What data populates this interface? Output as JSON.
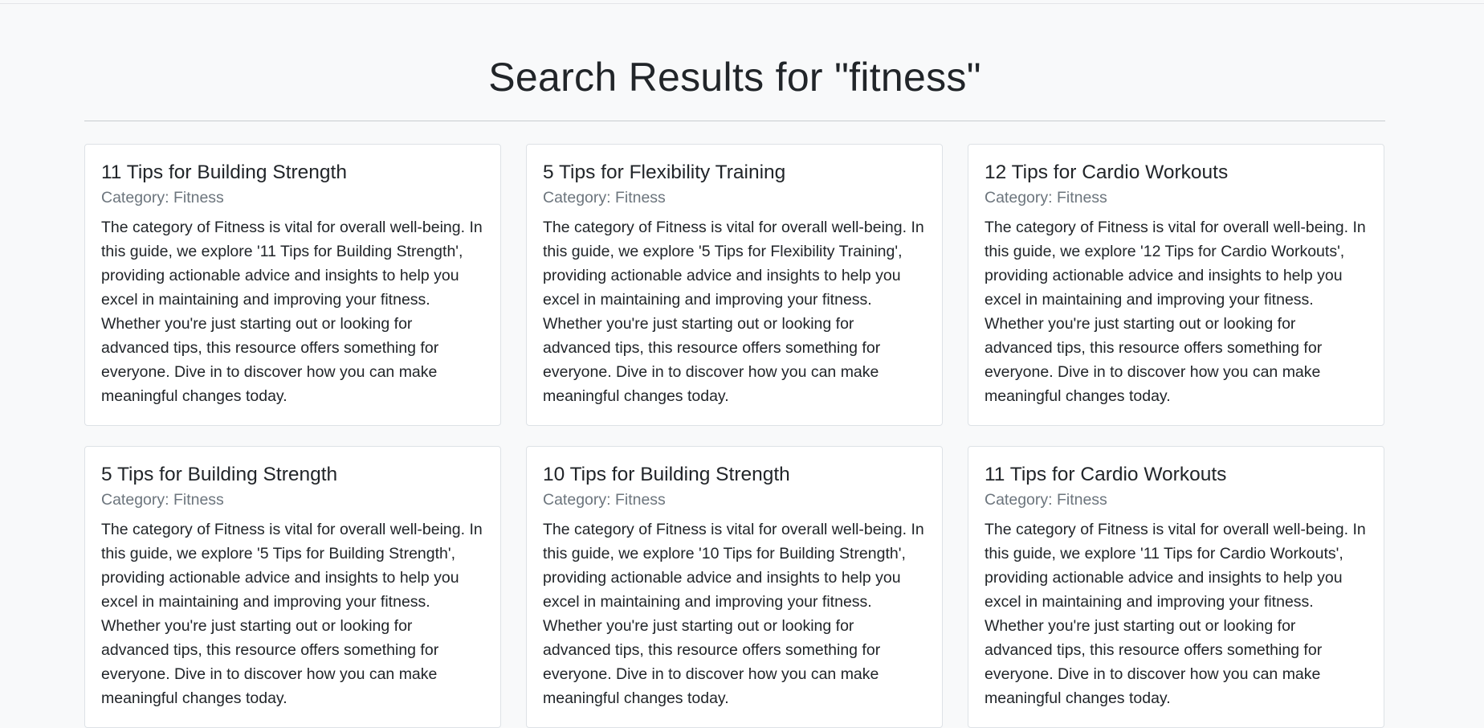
{
  "page": {
    "title": "Search Results for \"fitness\""
  },
  "results": [
    {
      "title": "11 Tips for Building Strength",
      "category": "Category: Fitness",
      "description": "The category of Fitness is vital for overall well-being. In this guide, we explore '11 Tips for Building Strength', providing actionable advice and insights to help you excel in maintaining and improving your fitness. Whether you're just starting out or looking for advanced tips, this resource offers something for everyone. Dive in to discover how you can make meaningful changes today."
    },
    {
      "title": "5 Tips for Flexibility Training",
      "category": "Category: Fitness",
      "description": "The category of Fitness is vital for overall well-being. In this guide, we explore '5 Tips for Flexibility Training', providing actionable advice and insights to help you excel in maintaining and improving your fitness. Whether you're just starting out or looking for advanced tips, this resource offers something for everyone. Dive in to discover how you can make meaningful changes today."
    },
    {
      "title": "12 Tips for Cardio Workouts",
      "category": "Category: Fitness",
      "description": "The category of Fitness is vital for overall well-being. In this guide, we explore '12 Tips for Cardio Workouts', providing actionable advice and insights to help you excel in maintaining and improving your fitness. Whether you're just starting out or looking for advanced tips, this resource offers something for everyone. Dive in to discover how you can make meaningful changes today."
    },
    {
      "title": "5 Tips for Building Strength",
      "category": "Category: Fitness",
      "description": "The category of Fitness is vital for overall well-being. In this guide, we explore '5 Tips for Building Strength', providing actionable advice and insights to help you excel in maintaining and improving your fitness. Whether you're just starting out or looking for advanced tips, this resource offers something for everyone. Dive in to discover how you can make meaningful changes today."
    },
    {
      "title": "10 Tips for Building Strength",
      "category": "Category: Fitness",
      "description": "The category of Fitness is vital for overall well-being. In this guide, we explore '10 Tips for Building Strength', providing actionable advice and insights to help you excel in maintaining and improving your fitness. Whether you're just starting out or looking for advanced tips, this resource offers something for everyone. Dive in to discover how you can make meaningful changes today."
    },
    {
      "title": "11 Tips for Cardio Workouts",
      "category": "Category: Fitness",
      "description": "The category of Fitness is vital for overall well-being. In this guide, we explore '11 Tips for Cardio Workouts', providing actionable advice and insights to help you excel in maintaining and improving your fitness. Whether you're just starting out or looking for advanced tips, this resource offers something for everyone. Dive in to discover how you can make meaningful changes today."
    }
  ]
}
